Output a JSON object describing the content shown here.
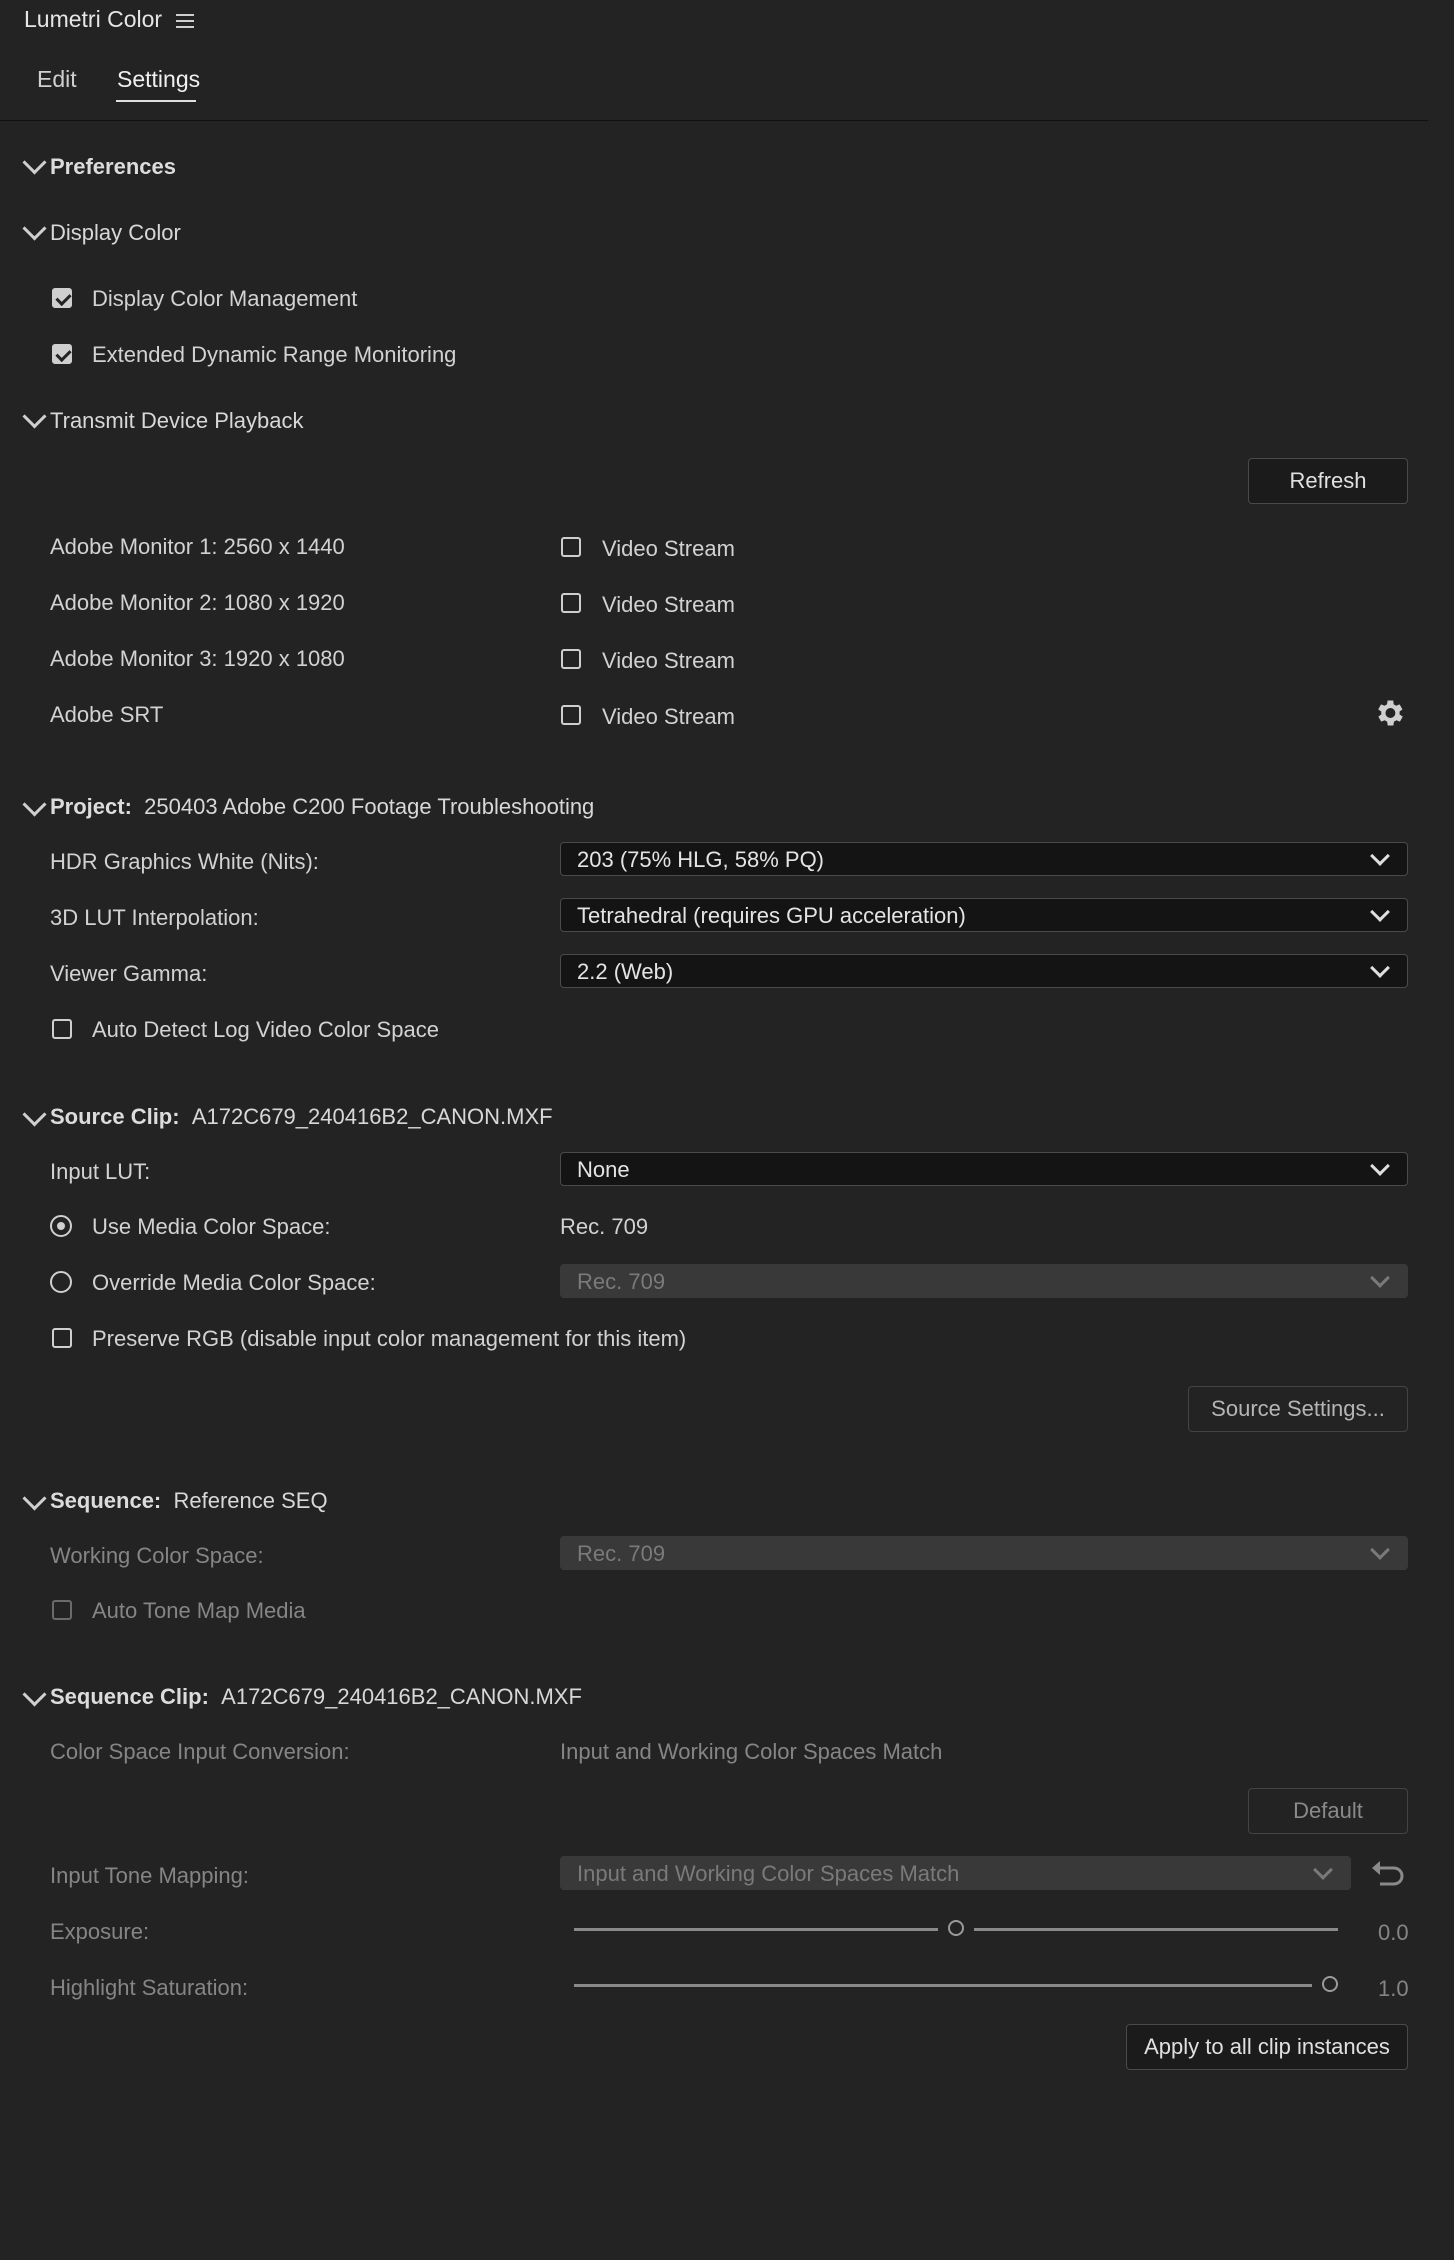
{
  "header": {
    "title": "Lumetri Color",
    "menu_icon": "hamburger-icon"
  },
  "tabs": [
    {
      "label": "Edit"
    },
    {
      "label": "Settings",
      "active": true
    }
  ],
  "preferences": {
    "label": "Preferences"
  },
  "display_color": {
    "label": "Display Color",
    "options": [
      {
        "label": "Display Color Management",
        "checked": true
      },
      {
        "label": "Extended Dynamic Range Monitoring",
        "checked": true
      }
    ]
  },
  "transmit": {
    "label": "Transmit Device Playback",
    "refresh_label": "Refresh",
    "devices": [
      {
        "name": "Adobe Monitor 1: 2560 x 1440",
        "stream_label": "Video Stream",
        "checked": false
      },
      {
        "name": "Adobe Monitor 2: 1080 x 1920",
        "stream_label": "Video Stream",
        "checked": false
      },
      {
        "name": "Adobe Monitor 3: 1920 x 1080",
        "stream_label": "Video Stream",
        "checked": false
      },
      {
        "name": "Adobe SRT",
        "stream_label": "Video Stream",
        "checked": false
      }
    ],
    "gear_icon": "gear-icon"
  },
  "project": {
    "label": "Project:",
    "name": "250403 Adobe C200 Footage Troubleshooting",
    "hdr_label": "HDR Graphics White (Nits):",
    "hdr_value": "203 (75% HLG, 58% PQ)",
    "lut_interp_label": "3D LUT Interpolation:",
    "lut_interp_value": "Tetrahedral (requires GPU acceleration)",
    "gamma_label": "Viewer Gamma:",
    "gamma_value": "2.2 (Web)",
    "auto_detect_label": "Auto Detect Log Video Color Space",
    "auto_detect_checked": false
  },
  "source_clip": {
    "label": "Source Clip:",
    "name": "A172C679_240416B2_CANON.MXF",
    "input_lut_label": "Input LUT:",
    "input_lut_value": "None",
    "use_media_label": "Use Media Color Space:",
    "use_media_value": "Rec. 709",
    "override_label": "Override Media Color Space:",
    "override_value": "Rec. 709",
    "preserve_label": "Preserve RGB (disable input color management for this item)",
    "source_settings_label": "Source Settings..."
  },
  "sequence": {
    "label": "Sequence:",
    "name": "Reference SEQ",
    "working_label": "Working Color Space:",
    "working_value": "Rec. 709",
    "tone_map_label": "Auto Tone Map Media"
  },
  "sequence_clip": {
    "label": "Sequence Clip:",
    "name": "A172C679_240416B2_CANON.MXF",
    "conversion_label": "Color Space Input Conversion:",
    "conversion_value": "Input and Working Color Spaces Match",
    "default_label": "Default",
    "tone_mapping_label": "Input Tone Mapping:",
    "tone_mapping_value": "Input and Working Color Spaces Match",
    "exposure_label": "Exposure:",
    "exposure_value": "0.0",
    "exposure_fraction": 0.5,
    "highlight_label": "Highlight Saturation:",
    "highlight_value": "1.0",
    "highlight_fraction": 1.0,
    "apply_label": "Apply to all clip instances"
  }
}
